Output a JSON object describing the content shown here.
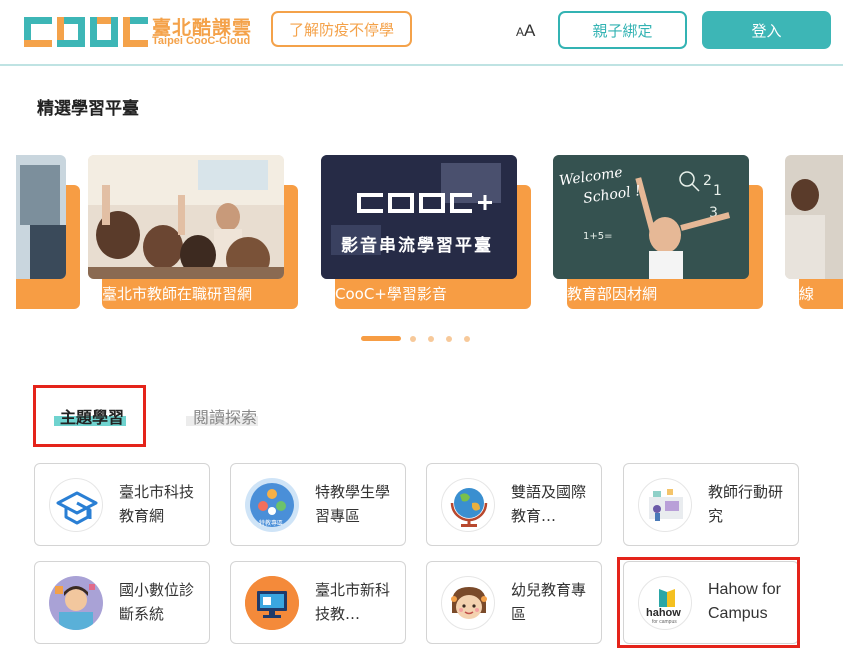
{
  "header": {
    "logo_cn": "臺北酷課雲",
    "logo_en": "Taipei CooC-Cloud",
    "covid_button": "了解防疫不停學",
    "font_size_small": "A",
    "font_size_big": "A",
    "parent_button": "親子綁定",
    "login_button": "登入"
  },
  "featured": {
    "title": "精選學習平臺",
    "cards": [
      {
        "label": "臺北市教師在職研習網"
      },
      {
        "label": "CooC+學習影音",
        "img_title": "影音串流學習平臺"
      },
      {
        "label": "教育部因材網",
        "img_text1": "Welcome",
        "img_text2": "School !"
      },
      {
        "label": "線"
      }
    ],
    "dots_total": 5,
    "dots_active": 0
  },
  "tabs": [
    {
      "label": "主題學習",
      "active": true
    },
    {
      "label": "閱讀探索",
      "active": false
    }
  ],
  "topics": [
    {
      "label": "臺北市科技教育網",
      "icon": "graduation-cap-icon"
    },
    {
      "label": "特教學生學習專區",
      "icon": "special-ed-icon",
      "icon_text": "特教專區"
    },
    {
      "label": "雙語及國際教育…",
      "icon": "globe-icon"
    },
    {
      "label": "教師行動研究",
      "icon": "research-icon"
    },
    {
      "label": "國小數位診斷系統",
      "icon": "student-avatar-icon"
    },
    {
      "label": "臺北市新科技教…",
      "icon": "monitor-icon"
    },
    {
      "label": "幼兒教育專區",
      "icon": "child-face-icon"
    },
    {
      "label": "Hahow for Campus",
      "icon": "hahow-logo-icon",
      "icon_text": "hahow",
      "icon_subtext": "for campus"
    }
  ],
  "colors": {
    "teal": "#3db6b6",
    "orange": "#f79d44",
    "red_highlight": "#e4231a"
  }
}
